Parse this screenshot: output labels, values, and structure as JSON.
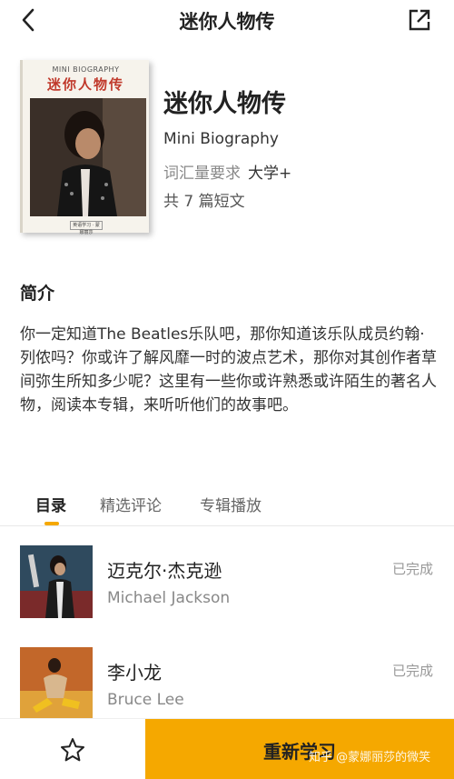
{
  "nav": {
    "title": "迷你人物传",
    "back_icon": "chevron-left-icon",
    "share_icon": "share-icon"
  },
  "cover": {
    "subtitle": "MINI BIOGRAPHY",
    "title": "迷你人物传",
    "badge": "英语学习 · 蒙娜丽莎"
  },
  "info": {
    "title": "迷你人物传",
    "english": "Mini Biography",
    "level_label": "词汇量要求",
    "level_value": "大学+",
    "count": "共 7 篇短文"
  },
  "intro": {
    "heading": "简介",
    "text": "你一定知道The Beatles乐队吧，那你知道该乐队成员约翰·列侬吗？你或许了解风靡一时的波点艺术，那你对其创作者草间弥生所知多少呢？这里有一些你或许熟悉或许陌生的著名人物，阅读本专辑，来听听他们的故事吧。"
  },
  "tabs": [
    {
      "label": "目录",
      "active": true
    },
    {
      "label": "精选评论",
      "active": false
    },
    {
      "label": "专辑播放",
      "active": false
    }
  ],
  "items": [
    {
      "title": "迈克尔·杰克逊",
      "subtitle": "Michael Jackson",
      "status": "已完成"
    },
    {
      "title": "李小龙",
      "subtitle": "Bruce Lee",
      "status": "已完成"
    }
  ],
  "bottom": {
    "favorite_icon": "star-outline-icon",
    "cta_label": "重新学习",
    "watermark": "知乎 @蒙娜丽莎的微笑"
  },
  "colors": {
    "accent": "#f5a800",
    "cover_title": "#c0392b"
  }
}
